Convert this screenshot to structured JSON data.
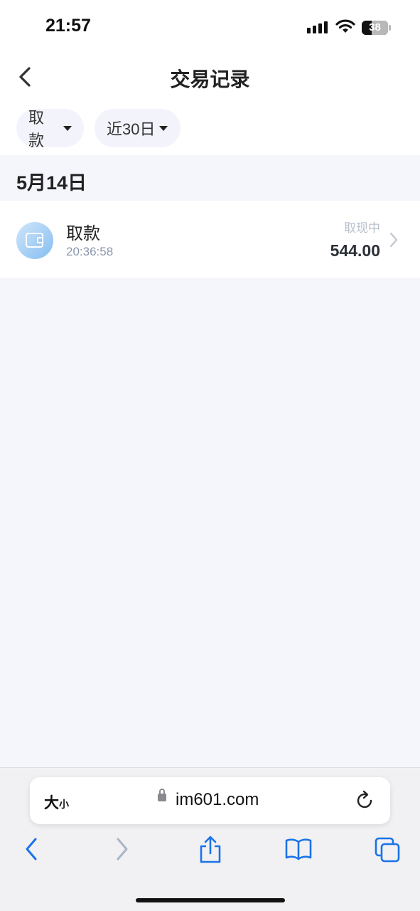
{
  "status_bar": {
    "time": "21:57",
    "battery": "38"
  },
  "header": {
    "title": "交易记录"
  },
  "filters": [
    {
      "label": "取款"
    },
    {
      "label": "近30日"
    }
  ],
  "transactions": {
    "date": "5月14日",
    "items": [
      {
        "name": "取款",
        "time": "20:36:58",
        "status": "取现中",
        "amount": "544.00"
      }
    ]
  },
  "browser": {
    "text_size": "大",
    "text_size_small": "小",
    "url": "im601.com"
  },
  "colors": {
    "accent": "#1a73e8",
    "icon_gradient_start": "#cfe6fb",
    "icon_gradient_end": "#86bdf0"
  }
}
